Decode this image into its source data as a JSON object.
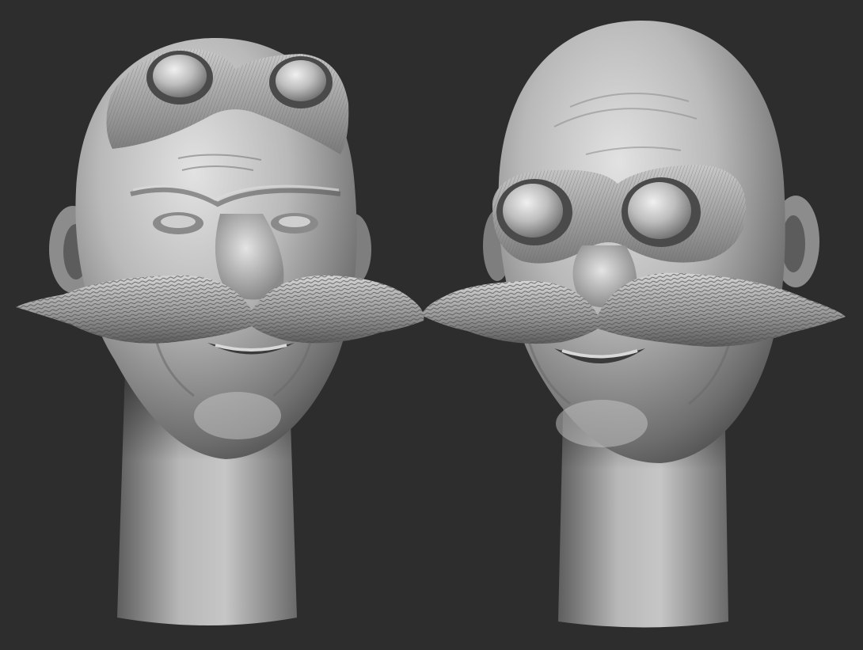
{
  "scene": {
    "background_color": "#2d2d2d",
    "clay_colors": {
      "highlight": "#dcdcdc",
      "mid": "#a8a8a8",
      "shadow": "#5a5a5a",
      "deep": "#3a3a3a"
    },
    "models": [
      {
        "name": "head-goggles-raised",
        "goggles_position": "forehead"
      },
      {
        "name": "head-goggles-on-eyes",
        "goggles_position": "eyes"
      }
    ]
  }
}
